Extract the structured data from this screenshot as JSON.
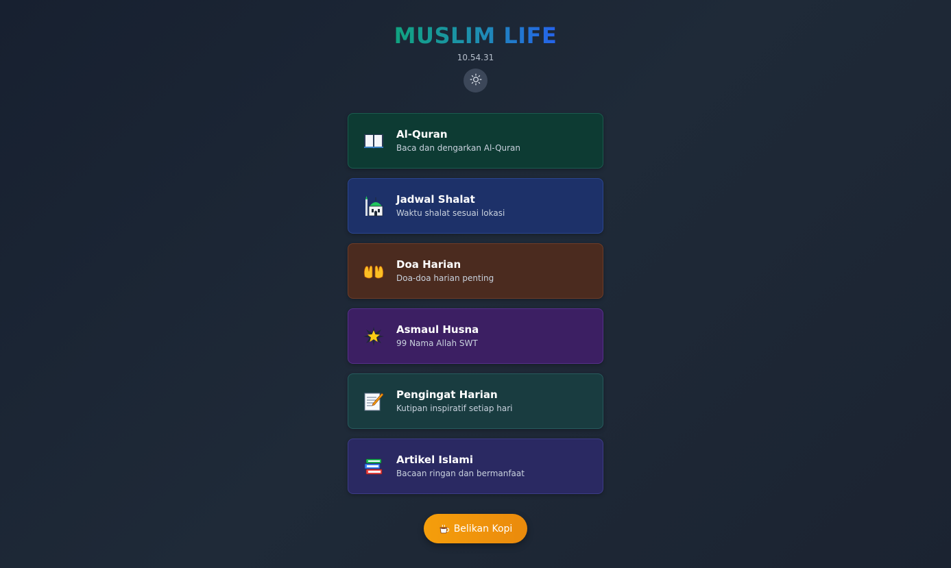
{
  "header": {
    "title": "MUSLIM LIFE",
    "time": "10.54.31",
    "theme_icon": "sun-icon"
  },
  "menu": [
    {
      "label": "Al-Quran",
      "desc": "Baca dan dengarkan Al-Quran",
      "icon": "book-icon",
      "color": "#0d3b33"
    },
    {
      "label": "Jadwal Shalat",
      "desc": "Waktu shalat sesuai lokasi",
      "icon": "mosque-icon",
      "color": "#1d3169"
    },
    {
      "label": "Doa Harian",
      "desc": "Doa-doa harian penting",
      "icon": "praying-hands-icon",
      "color": "#4b2b1f"
    },
    {
      "label": "Asmaul Husna",
      "desc": "99 Nama Allah SWT",
      "icon": "star-icon",
      "color": "#3c1f63"
    },
    {
      "label": "Pengingat Harian",
      "desc": "Kutipan inspiratif setiap hari",
      "icon": "memo-icon",
      "color": "#193c40"
    },
    {
      "label": "Artikel Islami",
      "desc": "Bacaan ringan dan bermanfaat",
      "icon": "books-icon",
      "color": "#2a2962"
    }
  ],
  "support": {
    "label": "Belikan Kopi",
    "icon": "coffee-icon",
    "color": "#f59e0b"
  }
}
